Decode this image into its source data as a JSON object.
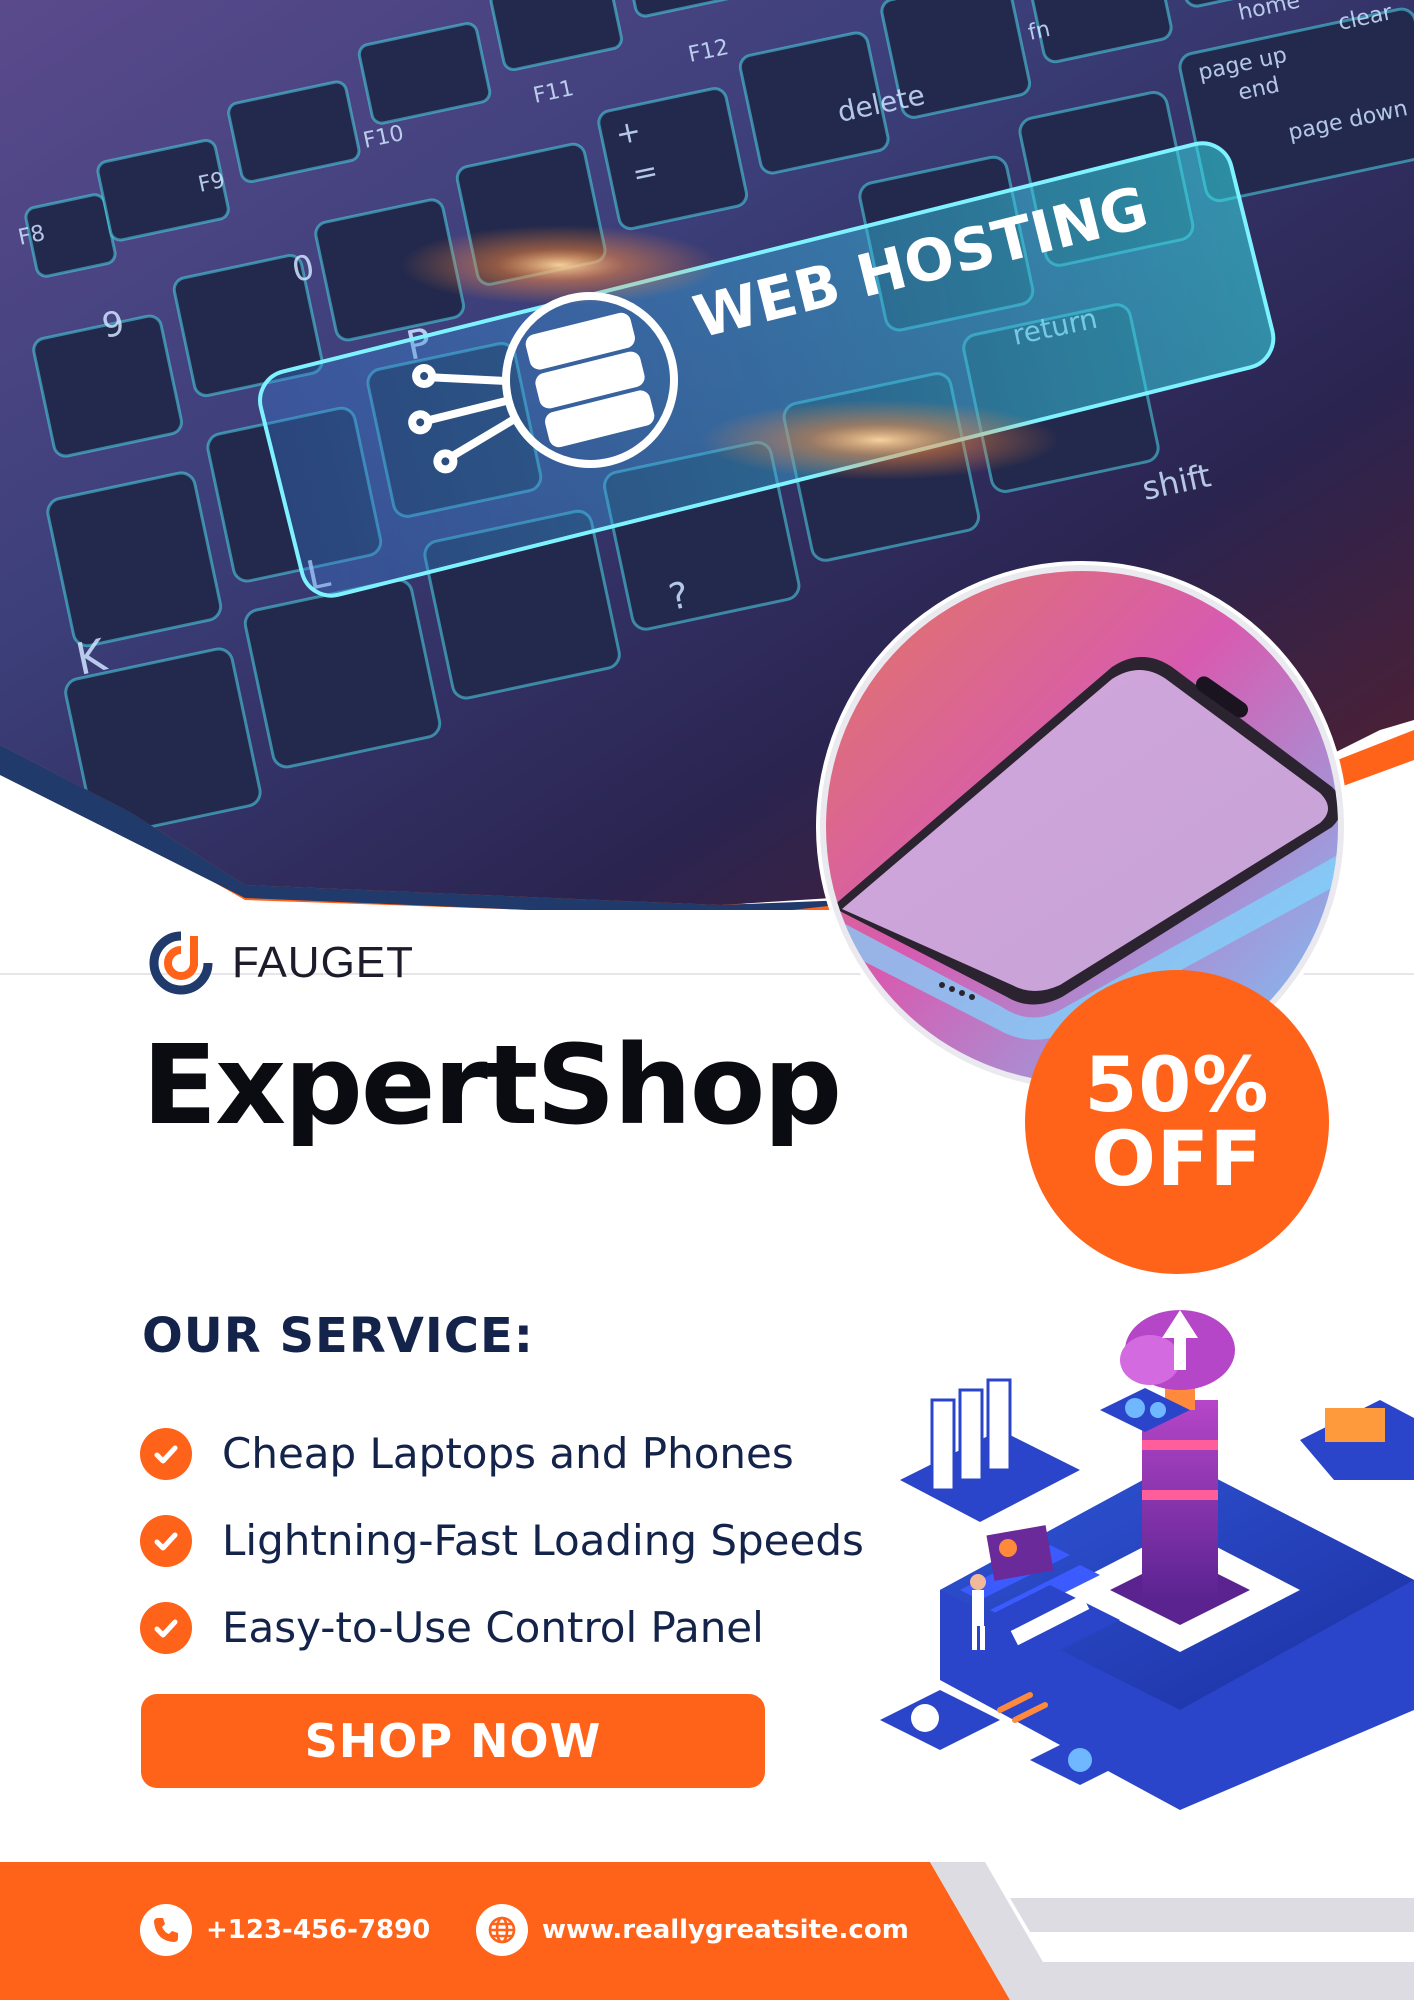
{
  "hero": {
    "image": "keyboard-web-hosting-photo",
    "key_label": "WEB HOSTING",
    "key_labels": [
      "F8",
      "F9",
      "F10",
      "F11",
      "F12",
      "fn",
      "home",
      "clear",
      "page up",
      "page down",
      "end",
      "delete",
      "return",
      "shift",
      "0",
      "9",
      "K",
      "L",
      "P",
      "?",
      "+",
      "="
    ]
  },
  "phone_image": "smartphone-photo",
  "brand": {
    "name": "FAUGET",
    "logo": "fauget-logo-icon"
  },
  "headline": "ExpertShop",
  "badge": {
    "line1": "50%",
    "line2": "OFF"
  },
  "service": {
    "title": "OUR SERVICE:",
    "items": [
      "Cheap Laptops and Phones",
      "Lightning-Fast Loading Speeds",
      "Easy-to-Use Control Panel"
    ]
  },
  "cta": {
    "label": "SHOP NOW"
  },
  "illustration": "isometric-server-datacenter-illustration",
  "footer": {
    "phone": "+123-456-7890",
    "website": "www.reallygreatsite.com"
  },
  "colors": {
    "accent": "#ff6219",
    "navy": "#13234a",
    "hero_dark": "#1b1d3f"
  }
}
